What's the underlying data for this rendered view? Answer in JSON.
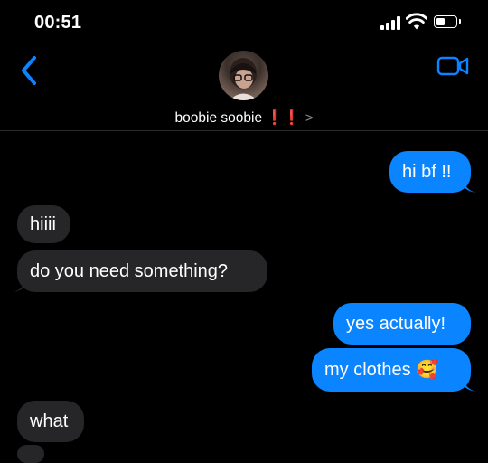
{
  "status_bar": {
    "time": "00:51"
  },
  "header": {
    "contact_name": "boobie soobie",
    "contact_emoji": "❗️❗️",
    "chevron": ">"
  },
  "icons": {
    "back": "chevron-left-icon",
    "video": "video-camera-icon",
    "signal": "cellular-signal-icon",
    "wifi": "wifi-icon",
    "battery": "battery-icon"
  },
  "colors": {
    "background": "#000000",
    "sent_bubble": "#0b84ff",
    "received_bubble": "#262629",
    "accent": "#0a84ff"
  },
  "messages": [
    {
      "sender": "me",
      "text": "hi bf !!"
    },
    {
      "sender": "them",
      "text": "hiiii"
    },
    {
      "sender": "them",
      "text": "do you need something?"
    },
    {
      "sender": "me",
      "text": "yes actually!"
    },
    {
      "sender": "me",
      "text": "my clothes 🥰"
    },
    {
      "sender": "them",
      "text": "what"
    }
  ]
}
